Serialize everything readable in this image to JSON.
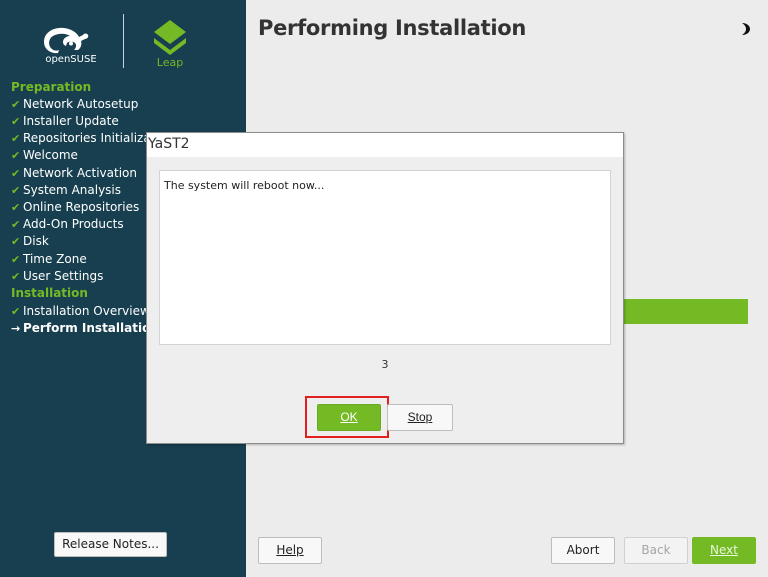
{
  "window": {
    "title": "Performing Installation"
  },
  "sidebar": {
    "logos": {
      "brand": "openSUSE",
      "product": "Leap"
    },
    "sections": [
      {
        "header": "Preparation",
        "items": [
          {
            "label": "Network Autosetup",
            "done": true
          },
          {
            "label": "Installer Update",
            "done": true
          },
          {
            "label": "Repositories Initialization",
            "done": true
          },
          {
            "label": "Welcome",
            "done": true
          },
          {
            "label": "Network Activation",
            "done": true
          },
          {
            "label": "System Analysis",
            "done": true
          },
          {
            "label": "Online Repositories",
            "done": true
          },
          {
            "label": "Add-On Products",
            "done": true
          },
          {
            "label": "Disk",
            "done": true
          },
          {
            "label": "Time Zone",
            "done": true
          },
          {
            "label": "User Settings",
            "done": true
          }
        ]
      },
      {
        "header": "Installation",
        "items": [
          {
            "label": "Installation Overview",
            "done": true
          },
          {
            "label": "Perform Installation",
            "current": true
          }
        ]
      }
    ],
    "release_notes_label": "Release Notes..."
  },
  "footer": {
    "help_label": "Help",
    "abort_label": "Abort",
    "back_label": "Back",
    "next_label": "Next"
  },
  "dialog": {
    "title": "YaST2",
    "message": "The system will reboot now...",
    "countdown": "3",
    "ok_label": "OK",
    "stop_label": "Stop"
  },
  "colors": {
    "sidebar_bg": "#173f4f",
    "accent_green": "#73ba25",
    "highlight_red": "#e21f1f"
  },
  "icons": {
    "check": "check-icon",
    "arrow": "arrow-right-icon",
    "theme": "moon-icon"
  }
}
